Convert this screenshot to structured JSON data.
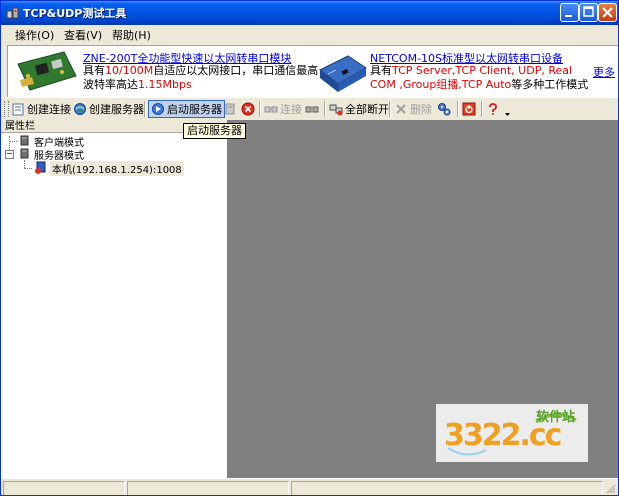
{
  "window": {
    "title": "TCP&UDP测试工具"
  },
  "menu": {
    "items": [
      "操作(O)",
      "查看(V)",
      "帮助(H)"
    ]
  },
  "banner": {
    "product1": {
      "link": "ZNE-200T全功能型快速以太网转串口模块",
      "line1_a": "具有",
      "line1_red": "10/100M",
      "line1_b": "自适应以太网接口，串口通信最高",
      "line2_a": "波特率高达",
      "line2_red": "1.15Mbps"
    },
    "product2": {
      "link": "NETCOM-10S标准型以太网转串口设备",
      "line1_a": "具有",
      "line1_red": "TCP Server,TCP Client, UDP, Real",
      "line2_red1": "COM ,Group组播,TCP Auto",
      "line2_b": "等多种工作模式"
    },
    "more": "更多"
  },
  "toolbar": {
    "create_connection": "创建连接",
    "create_server": "创建服务器",
    "start_server": "启动服务器",
    "connect": "连接",
    "disconnect_all": "全部断开",
    "delete": "删除"
  },
  "tooltip": "启动服务器",
  "tree": {
    "header": "属性栏",
    "client_mode": "客户端模式",
    "server_mode": "服务器模式",
    "local_server": "本机(192.168.1.254):1008"
  },
  "watermark": {
    "brand": "3322.cc",
    "sub": "软件站"
  },
  "colors": {
    "titlebar": "#0054e3",
    "workspace": "#808080",
    "link": "#0000ee",
    "highlight_red": "#e60000"
  }
}
